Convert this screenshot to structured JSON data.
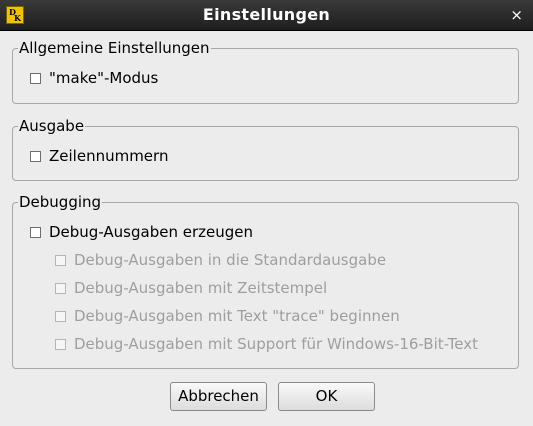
{
  "window": {
    "title": "Einstellungen",
    "icon_letters": [
      "D",
      "K"
    ],
    "close_glyph": "×",
    "icon": "app-icon"
  },
  "groups": {
    "general": {
      "label": "Allgemeine Einstellungen",
      "items": [
        {
          "label": "\"make\"-Modus",
          "checked": false,
          "enabled": true
        }
      ]
    },
    "output": {
      "label": "Ausgabe",
      "items": [
        {
          "label": "Zeilennummern",
          "checked": false,
          "enabled": true
        }
      ]
    },
    "debugging": {
      "label": "Debugging",
      "items": [
        {
          "label": "Debug-Ausgaben erzeugen",
          "checked": false,
          "enabled": true
        },
        {
          "label": "Debug-Ausgaben in die Standardausgabe",
          "checked": false,
          "enabled": false
        },
        {
          "label": "Debug-Ausgaben mit Zeitstempel",
          "checked": false,
          "enabled": false
        },
        {
          "label": "Debug-Ausgaben mit Text \"trace\" beginnen",
          "checked": false,
          "enabled": false
        },
        {
          "label": "Debug-Ausgaben mit Support für Windows-16-Bit-Text",
          "checked": false,
          "enabled": false
        }
      ]
    }
  },
  "buttons": {
    "cancel": "Abbrechen",
    "ok": "OK"
  },
  "colors": {
    "titlebar": "#2a2a2a",
    "background": "#ececec",
    "disabled_text": "#9e9e9e",
    "icon_yellow": "#f2c400"
  }
}
